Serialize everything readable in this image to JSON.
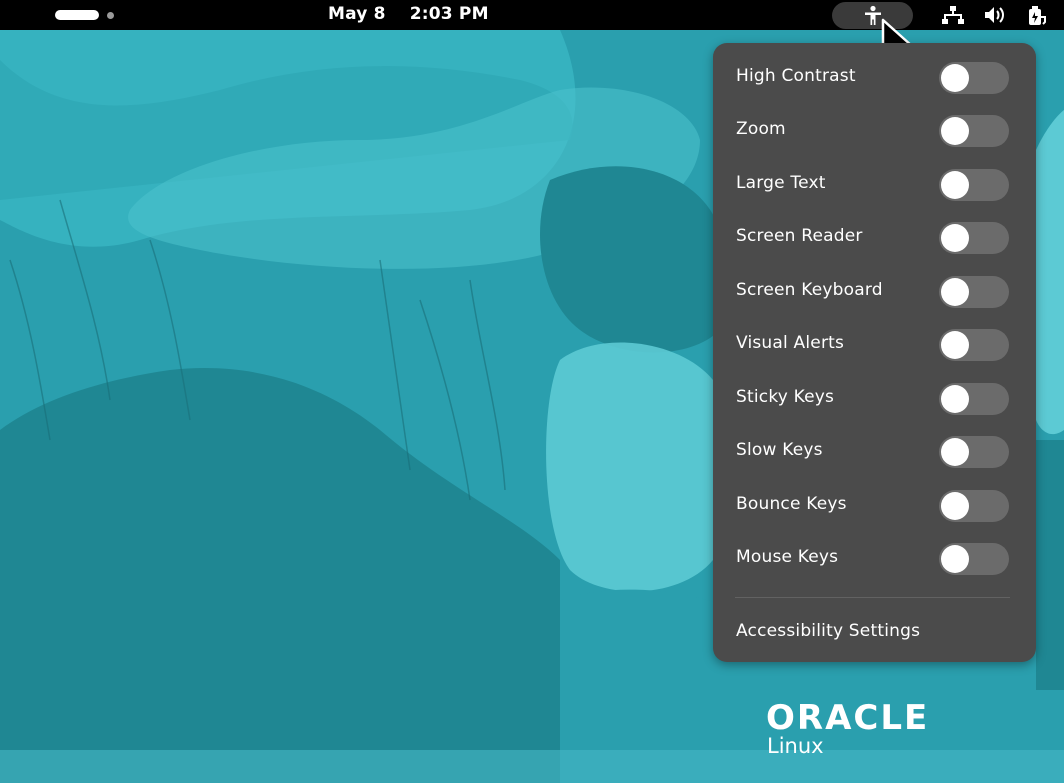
{
  "topbar": {
    "date": "May 8",
    "time": "2:03 PM",
    "icons": [
      "activities-pill-icon",
      "workspace-dot-icon",
      "accessibility-icon",
      "network-icon",
      "volume-icon",
      "battery-icon"
    ]
  },
  "a11y_menu": {
    "items": [
      {
        "label": "High Contrast",
        "enabled": false
      },
      {
        "label": "Zoom",
        "enabled": false
      },
      {
        "label": "Large Text",
        "enabled": false
      },
      {
        "label": "Screen Reader",
        "enabled": false
      },
      {
        "label": "Screen Keyboard",
        "enabled": false
      },
      {
        "label": "Visual Alerts",
        "enabled": false
      },
      {
        "label": "Sticky Keys",
        "enabled": false
      },
      {
        "label": "Slow Keys",
        "enabled": false
      },
      {
        "label": "Bounce Keys",
        "enabled": false
      },
      {
        "label": "Mouse Keys",
        "enabled": false
      }
    ],
    "settings_label": "Accessibility Settings"
  },
  "wallpaper": {
    "brand": "ORACLE",
    "product": "Linux"
  },
  "colors": {
    "topbar": "#000000",
    "menu_bg": "#4b4b4b",
    "toggle_off": "#6b6b6b",
    "wallpaper_teal": "#2a9fae",
    "wallpaper_dark": "#1e7d88",
    "wallpaper_light": "#5ccad4"
  }
}
